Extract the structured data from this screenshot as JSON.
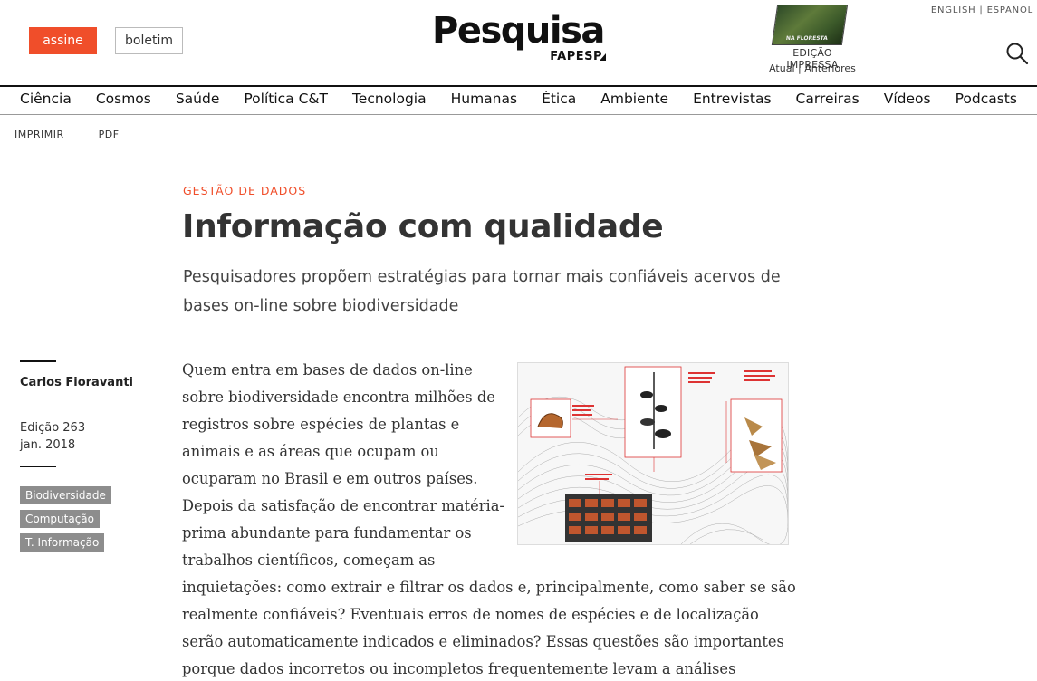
{
  "header": {
    "subscribe_label": "assine",
    "newsletter_label": "boletim",
    "logo_main": "Pesquisa",
    "logo_sub": "FAPESP",
    "print_edition_label": "EDIÇÃO IMPRESSA",
    "current_label": "Atual",
    "separator": "|",
    "previous_label": "Anteriores",
    "lang_english": "ENGLISH",
    "lang_sep": "|",
    "lang_espanol": "ESPAÑOL",
    "magazine_cover_text": "NA FLORESTA",
    "search_icon": "search-icon"
  },
  "nav": {
    "items": [
      "Ciência",
      "Cosmos",
      "Saúde",
      "Política C&T",
      "Tecnologia",
      "Humanas",
      "Ética",
      "Ambiente",
      "Entrevistas",
      "Carreiras",
      "Vídeos",
      "Podcasts"
    ]
  },
  "utils": {
    "print_label": "IMPRIMIR",
    "pdf_label": "PDF"
  },
  "article": {
    "section": "GESTÃO DE DADOS",
    "title": "Informação com qualidade",
    "subtitle": "Pesquisadores propõem estratégias para tornar mais confiáveis acervos de bases on-line sobre biodiversidade",
    "body": "Quem entra em bases de dados on-line sobre biodiversidade encontra milhões de registros sobre espécies de plantas e animais e as áreas que ocupam ou ocuparam no Brasil e em outros países. Depois da satisfação de encontrar matéria-prima abundante para fundamentar os trabalhos científicos, começam as inquietações: como extrair e filtrar os dados e, principalmente, como saber se são realmente confiáveis? Eventuais erros de nomes de espécies e de localização serão automaticamente indicados e eliminados? Essas questões são importantes porque dados incorretos ou incompletos frequentemente levam a análises inconsistentes."
  },
  "sidebar": {
    "author": "Carlos Fioravanti",
    "edition": "Edição 263",
    "date": "jan. 2018",
    "tags": [
      "Biodiversidade",
      "Computação",
      "T. Informação"
    ]
  },
  "colors": {
    "accent": "#f04e2a",
    "tag_bg": "#8d8d8d",
    "text": "#333333"
  }
}
